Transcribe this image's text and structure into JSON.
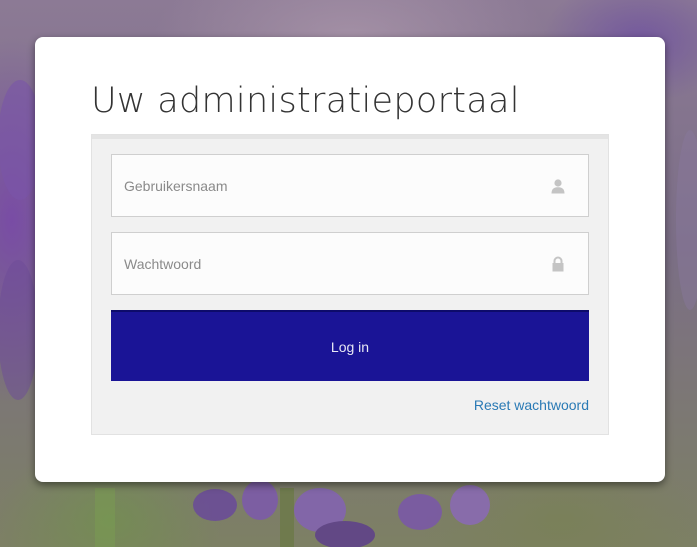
{
  "login": {
    "title": "Uw administratieportaal",
    "username": {
      "placeholder": "Gebruikersnaam",
      "value": "",
      "icon": "user-icon"
    },
    "password": {
      "placeholder": "Wachtwoord",
      "value": "",
      "icon": "lock-icon"
    },
    "submit_label": "Log in",
    "reset_label": "Reset wachtwoord"
  },
  "colors": {
    "button": "#1a1496",
    "link": "#2a7ab5",
    "card": "#ffffff",
    "panel": "#f1f1f1"
  }
}
